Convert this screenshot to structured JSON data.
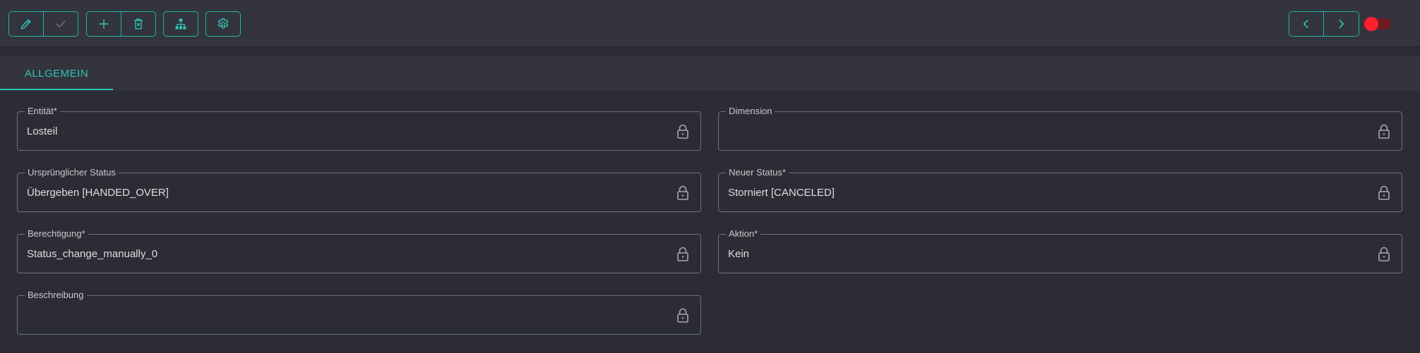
{
  "toolbar": {
    "groups": [
      {
        "buttons": [
          {
            "icon": "pencil-icon"
          },
          {
            "icon": "check-icon"
          }
        ]
      },
      {
        "buttons": [
          {
            "icon": "plus-icon"
          },
          {
            "icon": "delete-icon"
          }
        ]
      },
      {
        "buttons": [
          {
            "icon": "hierarchy-icon"
          }
        ]
      },
      {
        "buttons": [
          {
            "icon": "gear-icon"
          }
        ]
      }
    ],
    "nav": [
      {
        "icon": "chevron-left-icon"
      },
      {
        "icon": "chevron-right-icon"
      }
    ],
    "toggle": {
      "state": "off"
    }
  },
  "colors": {
    "accent": "#2ec4b6",
    "toggle": "#ff1f2d",
    "background": "#2b2c34",
    "panel": "#33343d"
  },
  "tabs": [
    {
      "label": "ALLGEMEIN",
      "active": true
    }
  ],
  "fields": {
    "entity": {
      "label": "Entität*",
      "value": "Losteil"
    },
    "dimension": {
      "label": "Dimension",
      "value": ""
    },
    "original_status": {
      "label": "Ursprünglicher Status",
      "value": "Übergeben [HANDED_OVER]"
    },
    "new_status": {
      "label": "Neuer Status*",
      "value": "Storniert [CANCELED]"
    },
    "permission": {
      "label": "Berechtigung*",
      "value": "Status_change_manually_0"
    },
    "action": {
      "label": "Aktion*",
      "value": "Kein"
    },
    "description": {
      "label": "Beschreibung",
      "value": ""
    }
  }
}
